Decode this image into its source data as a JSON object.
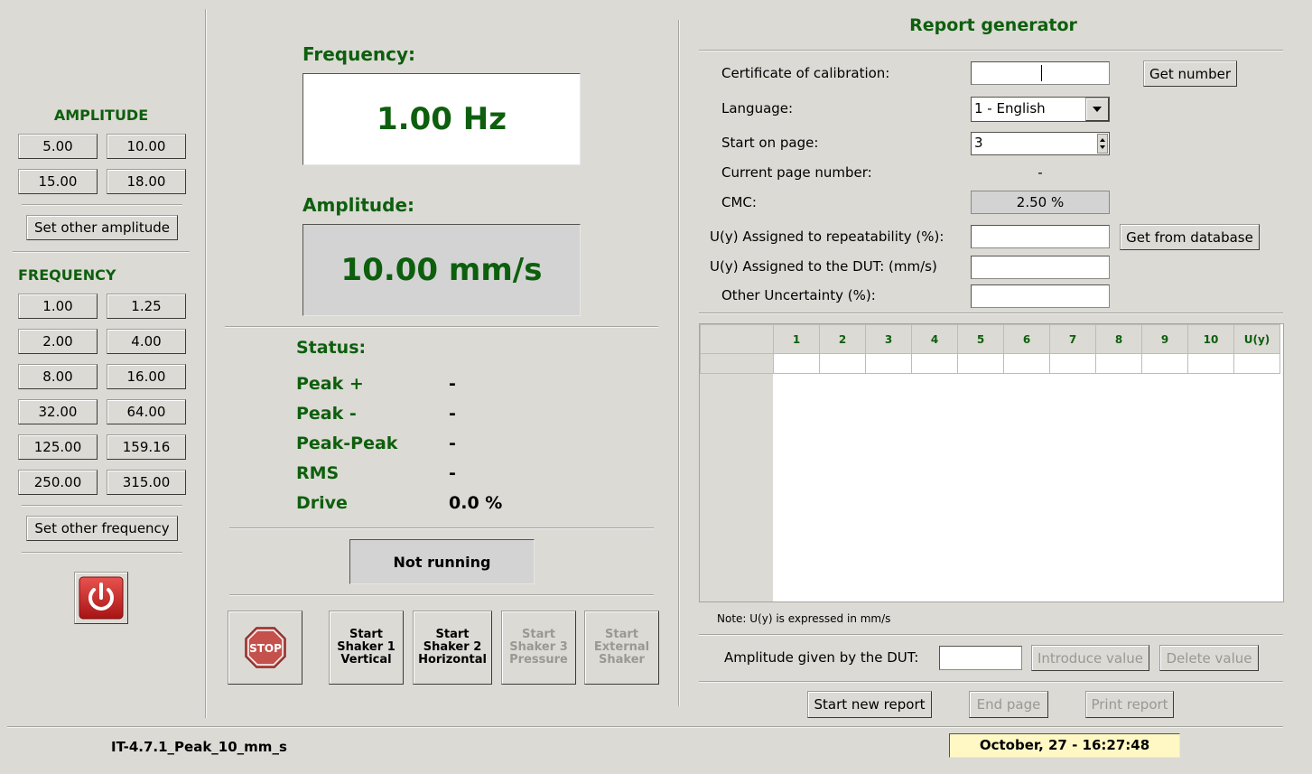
{
  "left": {
    "amplitude_title": "AMPLITUDE",
    "amplitude_buttons": [
      "5.00",
      "10.00",
      "15.00",
      "18.00"
    ],
    "set_other_amplitude": "Set other amplitude",
    "frequency_title": "FREQUENCY",
    "frequency_buttons": [
      "1.00",
      "1.25",
      "2.00",
      "4.00",
      "8.00",
      "16.00",
      "32.00",
      "64.00",
      "125.00",
      "159.16",
      "250.00",
      "315.00"
    ],
    "set_other_frequency": "Set other frequency",
    "power_icon": "power-icon"
  },
  "middle": {
    "frequency_label": "Frequency:",
    "frequency_value": "1.00 Hz",
    "amplitude_label": "Amplitude:",
    "amplitude_value": "10.00 mm/s",
    "status_label": "Status:",
    "status_rows": [
      {
        "name": "Peak +",
        "value": "-"
      },
      {
        "name": "Peak -",
        "value": "-"
      },
      {
        "name": "Peak-Peak",
        "value": "-"
      },
      {
        "name": "RMS",
        "value": "-"
      },
      {
        "name": "Drive",
        "value": "0.0 %"
      }
    ],
    "running_state": "Not running",
    "stop_label": "STOP",
    "shakers": [
      {
        "line1": "Start",
        "line2": "Shaker 1",
        "line3": "Vertical",
        "enabled": true
      },
      {
        "line1": "Start",
        "line2": "Shaker 2",
        "line3": "Horizontal",
        "enabled": true
      },
      {
        "line1": "Start",
        "line2": "Shaker 3",
        "line3": "Pressure",
        "enabled": false
      },
      {
        "line1": "Start",
        "line2": "External",
        "line3": "Shaker",
        "enabled": false
      }
    ]
  },
  "report": {
    "title": "Report generator",
    "certificate_label": "Certificate of calibration:",
    "certificate_value": "",
    "get_number": "Get number",
    "language_label": "Language:",
    "language_value": "1 - English",
    "start_page_label": "Start on page:",
    "start_page_value": "3",
    "current_page_label": "Current page number:",
    "current_page_value": "-",
    "cmc_label": "CMC:",
    "cmc_value": "2.50 %",
    "repeatability_label": "U(y) Assigned to repeatability (%):",
    "get_from_database": "Get from database",
    "dut_label": "U(y) Assigned to the DUT: (mm/s)",
    "other_label": "Other Uncertainty (%):",
    "table_headers": [
      "1",
      "2",
      "3",
      "4",
      "5",
      "6",
      "7",
      "8",
      "9",
      "10",
      "U(y)"
    ],
    "note": "Note: U(y) is expressed in mm/s",
    "amplitude_dut_label": "Amplitude given by the DUT:",
    "introduce_value": "Introduce value",
    "delete_value": "Delete value",
    "start_new_report": "Start new report",
    "end_page": "End page",
    "print_report": "Print report"
  },
  "statusbar": {
    "procedure": "IT-4.7.1_Peak_10_mm_s",
    "datetime": "October, 27 - 16:27:48"
  }
}
